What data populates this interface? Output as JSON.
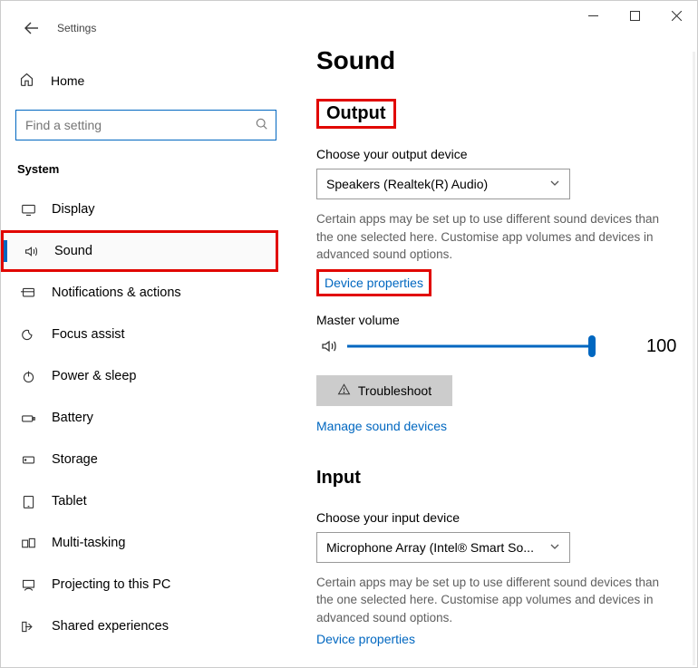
{
  "app_title": "Settings",
  "search": {
    "placeholder": "Find a setting"
  },
  "home_label": "Home",
  "category": "System",
  "nav": [
    {
      "label": "Display"
    },
    {
      "label": "Sound"
    },
    {
      "label": "Notifications & actions"
    },
    {
      "label": "Focus assist"
    },
    {
      "label": "Power & sleep"
    },
    {
      "label": "Battery"
    },
    {
      "label": "Storage"
    },
    {
      "label": "Tablet"
    },
    {
      "label": "Multi-tasking"
    },
    {
      "label": "Projecting to this PC"
    },
    {
      "label": "Shared experiences"
    }
  ],
  "page": {
    "title": "Sound",
    "output": {
      "heading": "Output",
      "choose_label": "Choose your output device",
      "device": "Speakers (Realtek(R) Audio)",
      "helper": "Certain apps may be set up to use different sound devices than the one selected here. Customise app volumes and devices in advanced sound options.",
      "device_properties": "Device properties",
      "master_volume_label": "Master volume",
      "master_volume_value": "100",
      "troubleshoot": "Troubleshoot",
      "manage_devices": "Manage sound devices"
    },
    "input": {
      "heading": "Input",
      "choose_label": "Choose your input device",
      "device": "Microphone Array (Intel® Smart So...",
      "helper": "Certain apps may be set up to use different sound devices than the one selected here. Customise app volumes and devices in advanced sound options.",
      "device_properties": "Device properties"
    }
  }
}
